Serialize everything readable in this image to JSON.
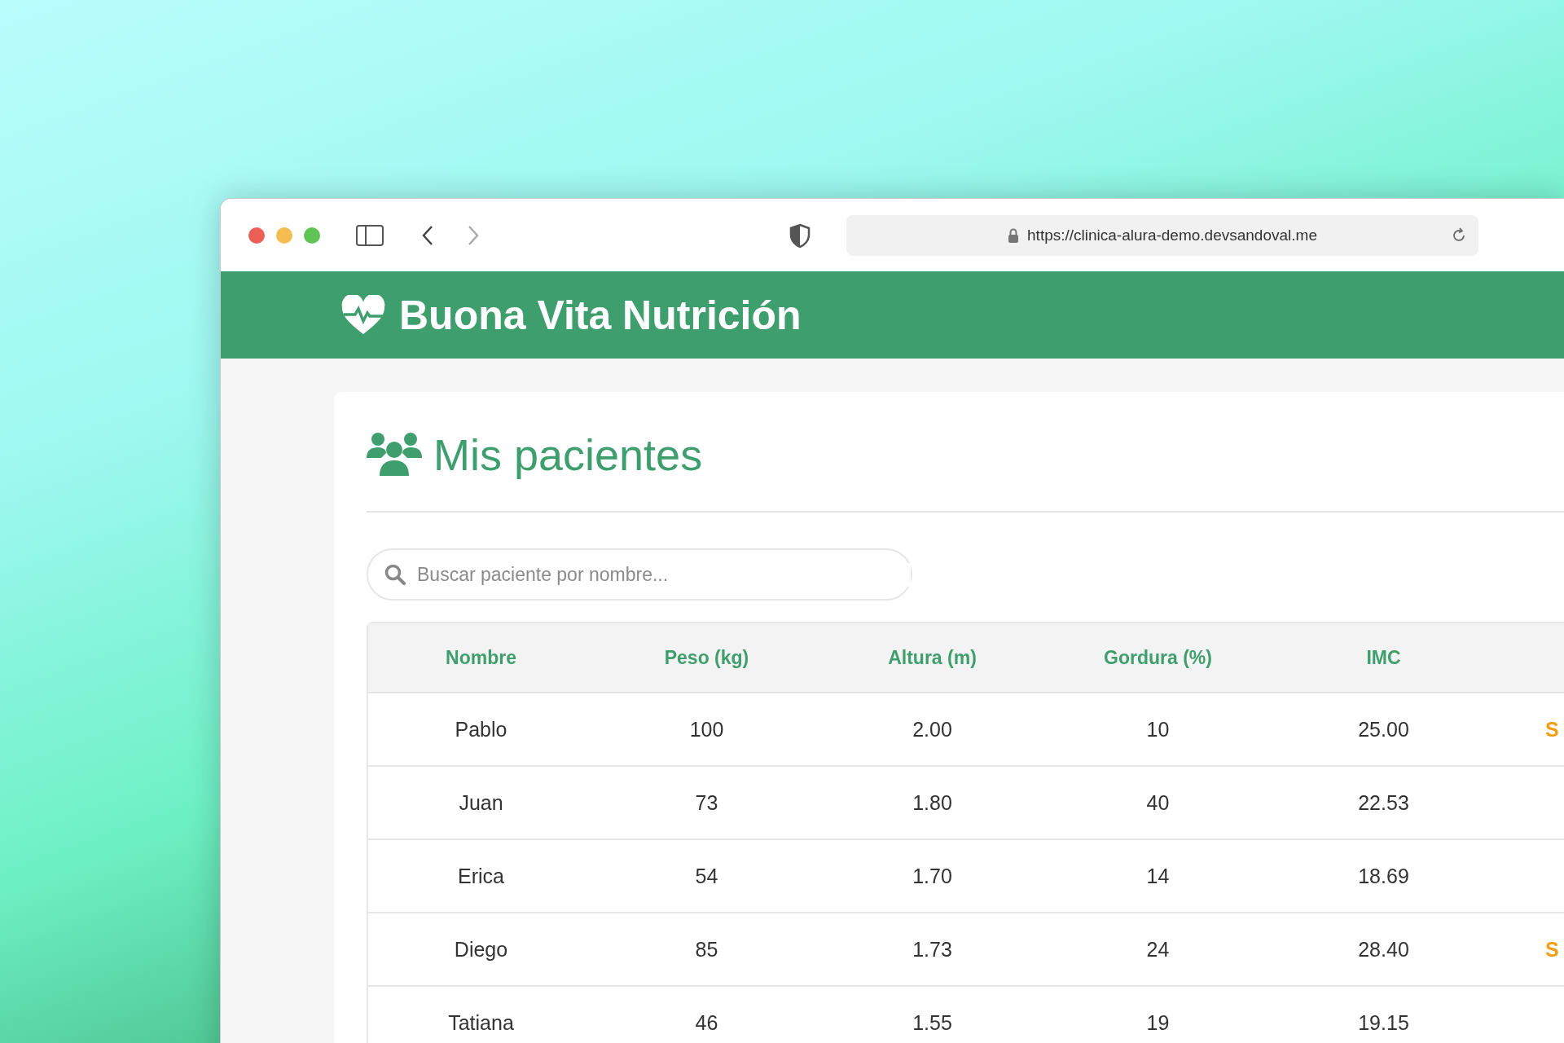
{
  "browser": {
    "url": "https://clinica-alura-demo.devsandoval.me"
  },
  "header": {
    "title": "Buona Vita Nutrición"
  },
  "page": {
    "title": "Mis pacientes"
  },
  "search": {
    "placeholder": "Buscar paciente por nombre..."
  },
  "table": {
    "columns": [
      "Nombre",
      "Peso (kg)",
      "Altura (m)",
      "Gordura (%)",
      "IMC"
    ],
    "rows": [
      {
        "cells": [
          "Pablo",
          "100",
          "2.00",
          "10",
          "25.00"
        ],
        "column_6": "S"
      },
      {
        "cells": [
          "Juan",
          "73",
          "1.80",
          "40",
          "22.53"
        ]
      },
      {
        "cells": [
          "Erica",
          "54",
          "1.70",
          "14",
          "18.69"
        ]
      },
      {
        "cells": [
          "Diego",
          "85",
          "1.73",
          "24",
          "28.40"
        ],
        "column_6": "S"
      },
      {
        "cells": [
          "Tatiana",
          "46",
          "1.55",
          "19",
          "19.15"
        ]
      }
    ]
  }
}
